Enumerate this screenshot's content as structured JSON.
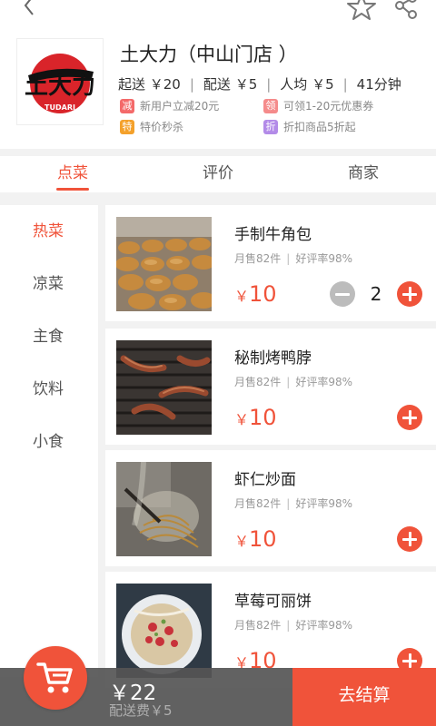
{
  "store": {
    "name": "土大力（中山门店 ）",
    "logo_text": "土大力",
    "logo_subtitle": "TUDARI",
    "stats": {
      "min_order": "起送 ￥20",
      "delivery": "配送 ￥5",
      "per_person": "人均 ￥5",
      "time": "41分钟"
    },
    "promos": [
      {
        "tag": "减",
        "text": "新用户立减20元",
        "color": "#f46a6a"
      },
      {
        "tag": "领",
        "text": "可领1-20元优惠券",
        "color": "#f58b8b"
      },
      {
        "tag": "特",
        "text": "特价秒杀",
        "color": "#f4a12b"
      },
      {
        "tag": "折",
        "text": "折扣商品5折起",
        "color": "#b38be8"
      }
    ]
  },
  "tabs": [
    {
      "label": "点菜",
      "active": true
    },
    {
      "label": "评价",
      "active": false
    },
    {
      "label": "商家",
      "active": false
    }
  ],
  "categories": [
    {
      "label": "热菜",
      "active": true
    },
    {
      "label": "凉菜",
      "active": false
    },
    {
      "label": "主食",
      "active": false
    },
    {
      "label": "饮料",
      "active": false
    },
    {
      "label": "小食",
      "active": false
    }
  ],
  "items": [
    {
      "name": "手制牛角包",
      "sold": "月售82件",
      "rating": "好评率98%",
      "currency": "￥",
      "price": "10",
      "qty": "2"
    },
    {
      "name": "秘制烤鸭脖",
      "sold": "月售82件",
      "rating": "好评率98%",
      "currency": "￥",
      "price": "10"
    },
    {
      "name": "虾仁炒面",
      "sold": "月售82件",
      "rating": "好评率98%",
      "currency": "￥",
      "price": "10"
    },
    {
      "name": "草莓可丽饼",
      "sold": "月售82件",
      "rating": "好评率98%",
      "currency": "￥",
      "price": "10"
    }
  ],
  "cart": {
    "total": "￥22",
    "fee": "配送费￥5",
    "checkout_label": "去结算"
  },
  "colors": {
    "accent": "#f0533a",
    "cart_bar": "#555555"
  }
}
